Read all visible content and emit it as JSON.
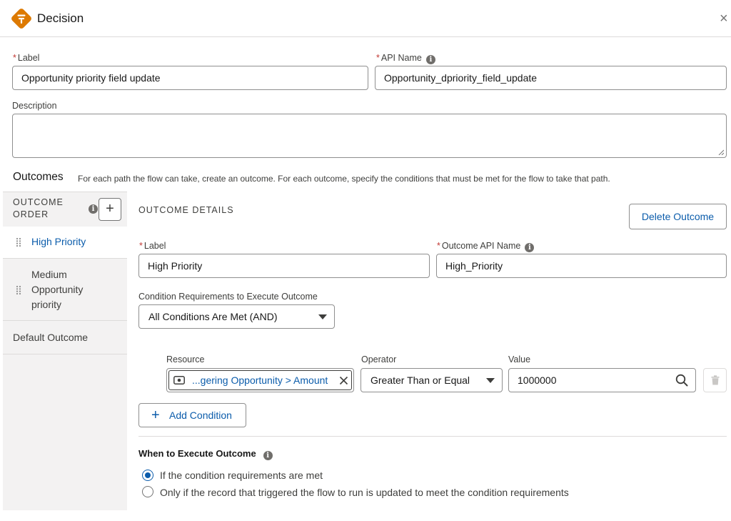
{
  "header": {
    "title": "Decision",
    "close_label": "×"
  },
  "form": {
    "required_mark": "*",
    "label_field": {
      "label": "Label",
      "value": "Opportunity priority field update"
    },
    "api_name_field": {
      "label": "API Name",
      "value": "Opportunity_dpriority_field_update"
    },
    "description_field": {
      "label": "Description",
      "value": ""
    }
  },
  "outcomes": {
    "title": "Outcomes",
    "description": "For each path the flow can take, create an outcome. For each outcome, specify the conditions that must be met for the flow to take that path."
  },
  "sidebar": {
    "order_label_line1": "OUTCOME",
    "order_label_line2": "ORDER",
    "add_label": "+",
    "items": [
      {
        "label": "High Priority",
        "active": true
      },
      {
        "label_line1": "Medium",
        "label_line2": "Opportunity",
        "label_line3": "priority",
        "active": false
      },
      {
        "label": "Default Outcome",
        "active": false
      }
    ]
  },
  "details": {
    "title": "OUTCOME DETAILS",
    "delete_label": "Delete Outcome",
    "label_field": {
      "label": "Label",
      "value": "High Priority"
    },
    "api_name_field": {
      "label": "Outcome API Name",
      "value": "High_Priority"
    },
    "condition_req": {
      "label": "Condition Requirements to Execute Outcome",
      "value": "All Conditions Are Met (AND)"
    },
    "condition": {
      "resource_label": "Resource",
      "resource_value": "...gering Opportunity > Amount",
      "operator_label": "Operator",
      "operator_value": "Greater Than or Equal",
      "value_label": "Value",
      "value_value": "1000000"
    },
    "add_condition_label": "Add Condition",
    "add_condition_plus": "+",
    "when": {
      "title": "When to Execute Outcome",
      "options": [
        {
          "label": "If the condition requirements are met",
          "checked": true
        },
        {
          "label": "Only if the record that triggered the flow to run is updated to meet the condition requirements",
          "checked": false
        }
      ]
    }
  },
  "icons": {
    "decision": "decision-diamond-icon",
    "info": "info-icon",
    "grip": "drag-handle-icon",
    "resource": "currency-field-icon",
    "clear": "clear-x-icon",
    "search": "search-icon",
    "trash": "trash-icon"
  },
  "colors": {
    "brand_orange": "#dd7a01",
    "link_blue": "#0b5cab",
    "required_red": "#c23934",
    "sidebar_bg": "#f3f2f2",
    "border": "#8f8f8f"
  },
  "info_glyph": "i"
}
